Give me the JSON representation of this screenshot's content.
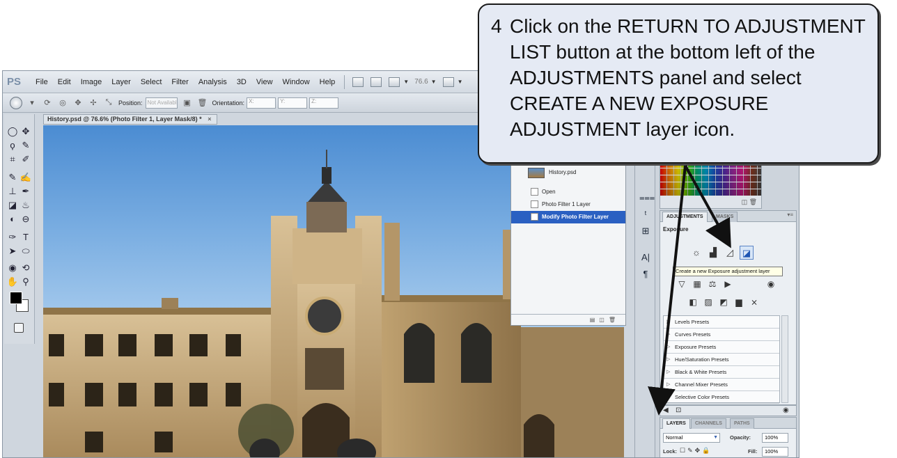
{
  "app": {
    "logo": "PS",
    "menu": [
      "File",
      "Edit",
      "Image",
      "Layer",
      "Select",
      "Filter",
      "Analysis",
      "3D",
      "View",
      "Window",
      "Help"
    ],
    "zoom": "76.6"
  },
  "options_bar": {
    "position_label": "Position:",
    "position_value": "Not Available",
    "orientation_label": "Orientation:",
    "x_label": "X:",
    "y_label": "Y:",
    "z_label": "Z:"
  },
  "document": {
    "tab_title": "History.psd @ 76.6% (Photo Filter 1, Layer Mask/8) *",
    "close": "×"
  },
  "history": {
    "snapshot": "History.psd",
    "items": [
      "Open",
      "Photo Filter 1 Layer",
      "Modify Photo Filter Layer"
    ]
  },
  "adjustments": {
    "tab": "ADJUSTMENTS",
    "masks_tab": "MASKS",
    "title": "Exposure",
    "tooltip": "Create a new Exposure adjustment layer",
    "presets": [
      "Levels Presets",
      "Curves Presets",
      "Exposure Presets",
      "Hue/Saturation Presets",
      "Black & White Presets",
      "Channel Mixer Presets",
      "Selective Color Presets"
    ]
  },
  "layers": {
    "tabs": [
      "LAYERS",
      "CHANNELS",
      "PATHS"
    ],
    "blend_mode": "Normal",
    "opacity_label": "Opacity:",
    "opacity": "100%",
    "lock_label": "Lock:",
    "fill_label": "Fill:",
    "fill": "100%"
  },
  "callout": {
    "step": "4",
    "text": "Click on the RETURN TO ADJUSTMENT LIST button at the bottom left of the ADJUSTMENTS panel and select CREATE A NEW EXPOSURE ADJUSTMENT layer icon."
  },
  "colors": {
    "callout_bg": "#e5eaf4",
    "selection_blue": "#2a60c2",
    "sky_blue": "#4b8cd2",
    "stone": "#c7a878"
  }
}
